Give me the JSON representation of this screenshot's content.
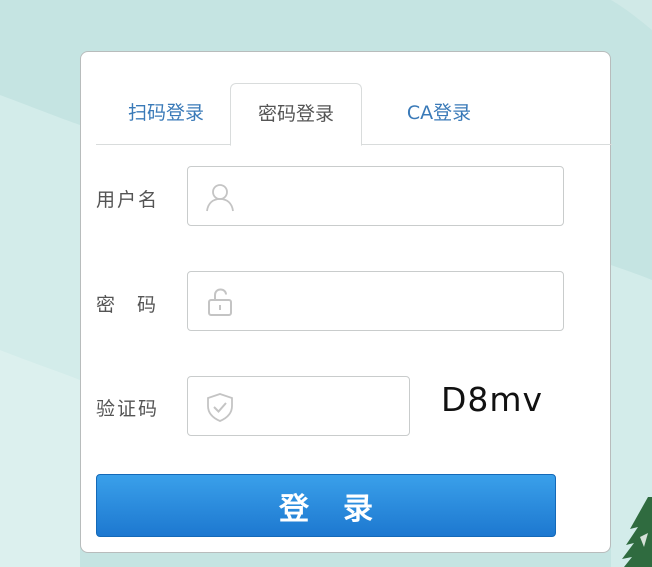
{
  "tabs": [
    {
      "label": "扫码登录",
      "active": false
    },
    {
      "label": "密码登录",
      "active": true
    },
    {
      "label": "CA登录",
      "active": false
    }
  ],
  "form": {
    "username_label": "用户名",
    "username_value": "",
    "password_label": "密码",
    "password_value": "",
    "captcha_label": "验证码",
    "captcha_value": "",
    "captcha_code": "D8mv",
    "submit_label": "登录"
  },
  "icons": {
    "username": "user-icon",
    "password": "unlock-icon",
    "captcha": "shield-check-icon"
  },
  "colors": {
    "background": "#c5e4e2",
    "tab_link": "#3a7ab8",
    "button": "#1d78d0"
  }
}
